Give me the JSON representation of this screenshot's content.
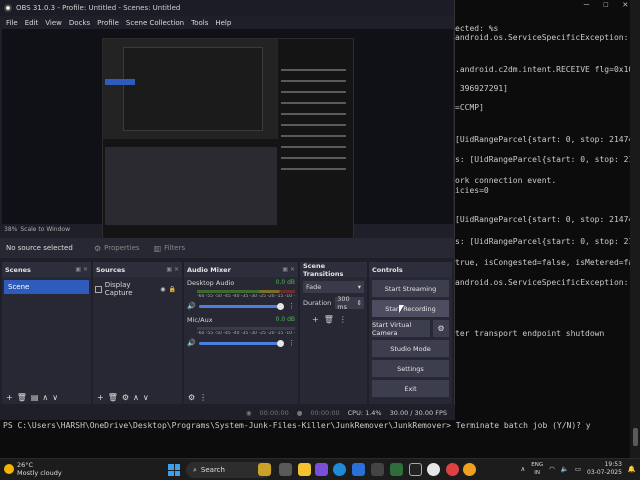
{
  "terminal": {
    "lines": [
      "ected: %s",
      "android.os.ServiceSpecificException:  (code",
      ".android.c2dm.intent.RECEIVE flg=0x10000000",
      " 396927291]",
      "=CCMP]",
      "[UidRangeParcel{start: 0, stop: 2147483647}",
      "s: [UidRangeParcel{start: 0, stop: 21474836",
      "ork connection event.",
      "icies=0",
      "[UidRangeParcel{start: 0, stop: 2147483647}",
      "s: [UidRangeParcel{start: 0, stop: 21474836",
      "true, isCongested=false, isMetered=false, i",
      "android.os.ServiceSpecificException:  (code",
      "ter transport endpoint shutdown"
    ],
    "prompt": "PS C:\\Users\\HARSH\\OneDrive\\Desktop\\Programs\\System-Junk-Files-Killer\\JunkRemover\\JunkRemover> Terminate batch job (Y/N)? y"
  },
  "obs": {
    "title": "OBS 31.0.3 - Profile: Untitled - Scenes: Untitled",
    "menu": [
      "File",
      "Edit",
      "View",
      "Docks",
      "Profile",
      "Scene Collection",
      "Tools",
      "Help"
    ],
    "zoom": [
      "38%",
      "Scale to Window"
    ],
    "source_bar": {
      "selected": "No source selected",
      "properties": "Properties",
      "filters": "Filters"
    },
    "scenes": {
      "title": "Scenes",
      "items": [
        "Scene"
      ]
    },
    "sources": {
      "title": "Sources",
      "items": [
        "Display Capture"
      ]
    },
    "mixer": {
      "title": "Audio Mixer",
      "channels": [
        {
          "name": "Desktop Audio",
          "db": "0.0 dB",
          "level": 1.0
        },
        {
          "name": "Mic/Aux",
          "db": "0.0 dB",
          "level": 1.0
        }
      ],
      "ticks": "-60 -55 -50 -45 -40 -35 -30 -25 -20 -15 -10 -5 0"
    },
    "transitions": {
      "title": "Scene Transitions",
      "type": "Fade",
      "duration_label": "Duration",
      "duration": "300 ms"
    },
    "controls": {
      "title": "Controls",
      "buttons": [
        "Start Streaming",
        "Start Recording",
        "Start Virtual Camera",
        "Studio Mode",
        "Settings",
        "Exit"
      ]
    },
    "status": {
      "stream_time": "00:00:00",
      "rec_time": "00:00:00",
      "cpu": "CPU: 1.4%",
      "fps": "30.00 / 30.00 FPS"
    }
  },
  "taskbar": {
    "weather_temp": "26°C",
    "weather_desc": "Mostly cloudy",
    "search": "Search",
    "lang_top": "ENG",
    "lang_bottom": "IN",
    "time": "19:53",
    "date": "03-07-2025",
    "colors": {
      "accent": "#2f5bbd",
      "start": "#3aa0f0"
    }
  }
}
